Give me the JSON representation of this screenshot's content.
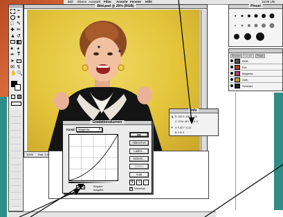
{
  "menubar": {
    "items": [
      "Datei",
      "Bearbeiten",
      "Bild",
      "Ebene",
      "Auswahl",
      "Filter",
      "Ansicht",
      "Fenster",
      "Hilfe"
    ],
    "clock": "15:05 Uhr"
  },
  "document": {
    "title": "Bild.psd @ 25% (RGB)",
    "status_left": "100%",
    "status_mid": "Dok: 2,54M/2,54M"
  },
  "swatches": {
    "title": "Pinsel"
  },
  "layers": {
    "tabs": [
      "Ebenen",
      "Kanäle",
      "Pfade"
    ],
    "items": [
      {
        "label": "RGB",
        "color": "#4d4d4d"
      },
      {
        "label": "Rot",
        "color": "#b23a2a"
      },
      {
        "label": "Magenta",
        "color": "#b03a74"
      },
      {
        "label": "Gelb",
        "color": "#b6a13a"
      },
      {
        "label": "Schwarz",
        "color": "#222222"
      }
    ]
  },
  "info_panel": {
    "title": "Info",
    "row1": "R: 233 G: 148 B: 120",
    "row2": "C: 12 M: 48 Y: 46 K: 0",
    "row3": "X: 9,42 Y: 11,31",
    "row4": "B: 0 H: 0"
  },
  "curves_dialog": {
    "title": "Gradationskurven",
    "channel_label": "Kanal:",
    "channel_value": "Magenta",
    "buttons": [
      "OK",
      "Abbrechen",
      "Laden...",
      "Sichern...",
      "Glätten",
      "Auto"
    ],
    "input_label": "Eingabe:",
    "output_label": "Ausgabe:",
    "preview_label": "Vorschau"
  },
  "colors": {
    "desktop": "#c94f1d",
    "image_bg": "#e3c43a"
  }
}
